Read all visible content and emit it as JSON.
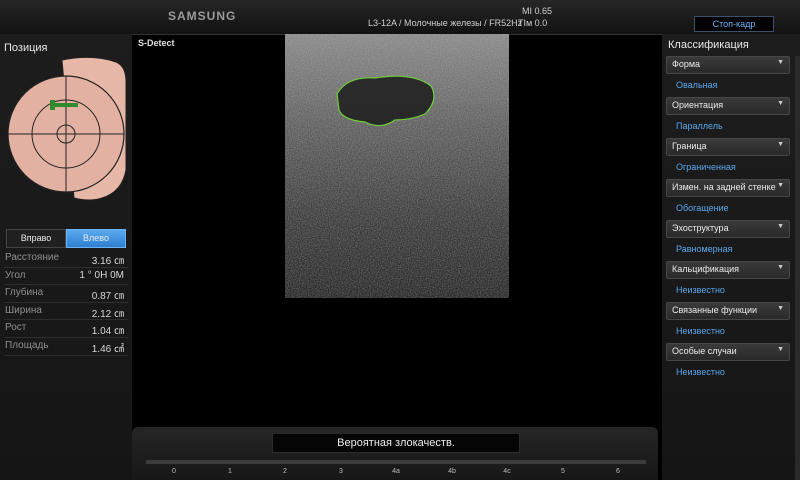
{
  "header": {
    "brand": "SAMSUNG",
    "probe_info": "L3-12A / Молочные железы / FR52Hz",
    "mi": "MI  0.65",
    "tim": "TIм  0.0",
    "freeze_button": "Стоп-кадр"
  },
  "left_panel": {
    "title": "Позиция",
    "side_buttons": {
      "right": "Вправо",
      "left": "Влево",
      "selected": "Влево"
    },
    "measurements": [
      {
        "label": "Расстояние",
        "value": "3.16 ㎝"
      },
      {
        "label": "Угол",
        "value": "1 ° 0H 0M"
      },
      {
        "label": "Глубина",
        "value": "0.87 ㎝"
      },
      {
        "label": "Ширина",
        "value": "2.12 ㎝"
      },
      {
        "label": "Рост",
        "value": "1.04 ㎝"
      },
      {
        "label": "Площадь",
        "value": "1.46 ㎠"
      }
    ]
  },
  "center": {
    "mode_label": "S-Detect",
    "result": "Вероятная злокачеств.",
    "scale_ticks": [
      "0",
      "1",
      "2",
      "3",
      "4a",
      "4b",
      "4c",
      "5",
      "6"
    ]
  },
  "right_panel": {
    "title": "Классификация",
    "categories": [
      {
        "label": "Форма",
        "value": "Овальная"
      },
      {
        "label": "Ориентация",
        "value": "Параллель"
      },
      {
        "label": "Граница",
        "value": "Ограниченная"
      },
      {
        "label": "Измен. на задней стенке",
        "value": "Обогащение"
      },
      {
        "label": "Эхоструктура",
        "value": "Равномерная"
      },
      {
        "label": "Кальцификация",
        "value": "Неизвестно"
      },
      {
        "label": "Связанные функции",
        "value": "Неизвестно"
      },
      {
        "label": "Особые случаи",
        "value": "Неизвестно"
      }
    ]
  },
  "colors": {
    "accent_blue": "#59a7ee",
    "selected_button": "#3a8fe0",
    "lesion_contour": "#6ecf3a",
    "breast_skin": "#e7b7a8"
  },
  "icons": {
    "dropdown": "chevron-down-icon",
    "probe_marker": "probe-marker-icon"
  }
}
